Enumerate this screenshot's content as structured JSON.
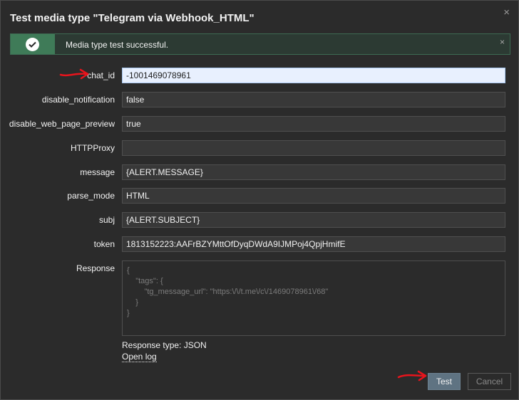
{
  "dialog": {
    "title": "Test media type \"Telegram via Webhook_HTML\"",
    "close_glyph": "×"
  },
  "banner": {
    "message": "Media type test successful.",
    "close_glyph": "×",
    "icon": "check-circle-icon"
  },
  "params": [
    {
      "label": "chat_id",
      "value": "-1001469078961"
    },
    {
      "label": "disable_notification",
      "value": "false"
    },
    {
      "label": "disable_web_page_preview",
      "value": "true"
    },
    {
      "label": "HTTPProxy",
      "value": ""
    },
    {
      "label": "message",
      "value": "{ALERT.MESSAGE}"
    },
    {
      "label": "parse_mode",
      "value": "HTML"
    },
    {
      "label": "subj",
      "value": "{ALERT.SUBJECT}"
    },
    {
      "label": "token",
      "value": "1813152223:AAFrBZYMttOfDyqDWdA9IJMPoj4QpjHmifE"
    }
  ],
  "response": {
    "label": "Response",
    "body": "{\n    \"tags\": {\n        \"tg_message_url\": \"https:\\/\\/t.me\\/c\\/1469078961\\/68\"\n    }\n}",
    "type_text": "Response type: JSON",
    "open_log": "Open log"
  },
  "buttons": {
    "test": "Test",
    "cancel": "Cancel"
  },
  "colors": {
    "annotation_arrow": "#e8141c",
    "success_green": "#3f7b58",
    "focused_field": "#e8f0fe"
  }
}
